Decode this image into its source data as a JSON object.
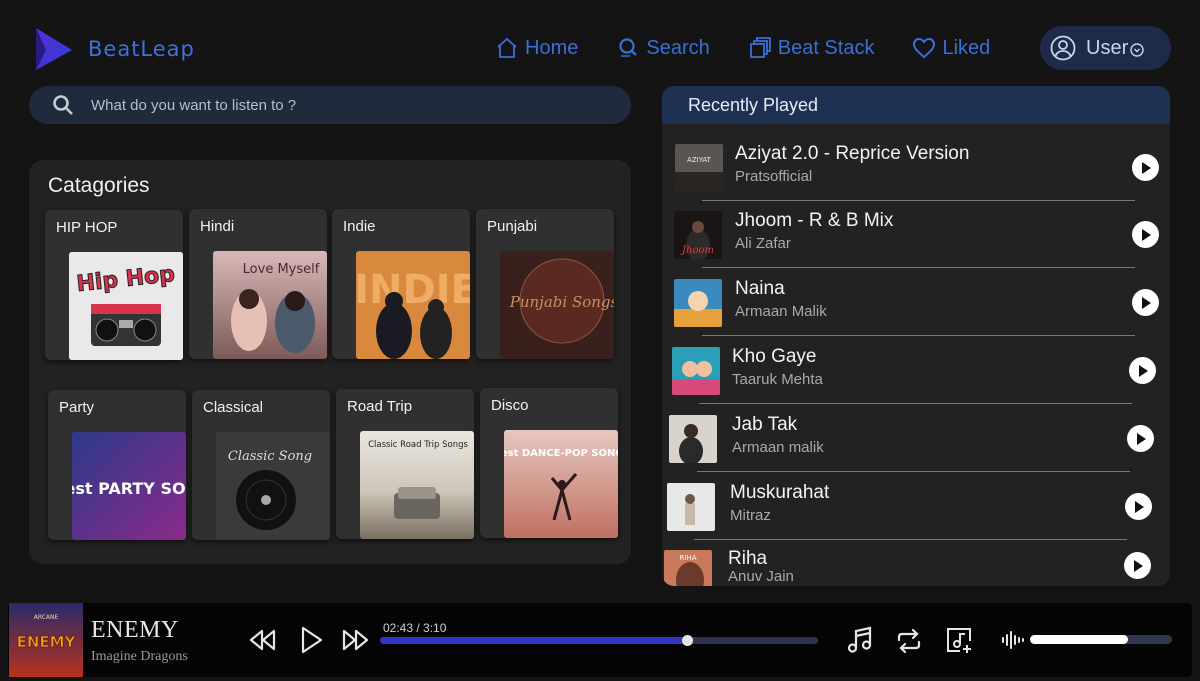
{
  "app": {
    "name": "BeatLeap",
    "accent": "#3a6fd6"
  },
  "nav": {
    "items": [
      {
        "label": "Home",
        "icon": "home-icon"
      },
      {
        "label": "Search",
        "icon": "search-icon"
      },
      {
        "label": "Beat Stack",
        "icon": "stack-icon"
      },
      {
        "label": "Liked",
        "icon": "heart-icon"
      }
    ],
    "user_label": "User"
  },
  "search": {
    "placeholder": "What do you want to listen to ?"
  },
  "categories": {
    "title": "Catagories",
    "items": [
      {
        "label": "HIP HOP",
        "art_text": "Hip Hop"
      },
      {
        "label": "Hindi",
        "art_text": "Love Myself"
      },
      {
        "label": "Indie",
        "art_text": "INDIE"
      },
      {
        "label": "Punjabi",
        "art_text": "Punjabi Songs"
      },
      {
        "label": "Party",
        "art_text": "Best PARTY SONGS"
      },
      {
        "label": "Classical",
        "art_text": "Classic Song"
      },
      {
        "label": "Road Trip",
        "art_text": "Classic Road Trip Songs"
      },
      {
        "label": "Disco",
        "art_text": "Best DANCE-POP SONGS"
      }
    ]
  },
  "recent": {
    "title": "Recently Played",
    "tracks": [
      {
        "title": "Aziyat 2.0 - Reprice Version",
        "artist": "Pratsofficial",
        "art_text": "AZIYAT"
      },
      {
        "title": "Jhoom - R & B Mix",
        "artist": "Ali Zafar",
        "art_text": "Jhoom"
      },
      {
        "title": "Naina",
        "artist": "Armaan Malik",
        "art_text": ""
      },
      {
        "title": "Kho Gaye",
        "artist": "Taaruk Mehta",
        "art_text": ""
      },
      {
        "title": "Jab Tak",
        "artist": "Armaan malik",
        "art_text": ""
      },
      {
        "title": "Muskurahat",
        "artist": "Mitraz",
        "art_text": ""
      },
      {
        "title": "Riha",
        "artist": "Anuv Jain",
        "art_text": "RIHA"
      }
    ]
  },
  "player": {
    "title": "ENEMY",
    "artist": "Imagine Dragons",
    "album_art_text": "ENEMY",
    "album_art_top": "ARCANE",
    "time": "02:43 / 3:10",
    "progress": 0.7,
    "volume": 0.69
  }
}
